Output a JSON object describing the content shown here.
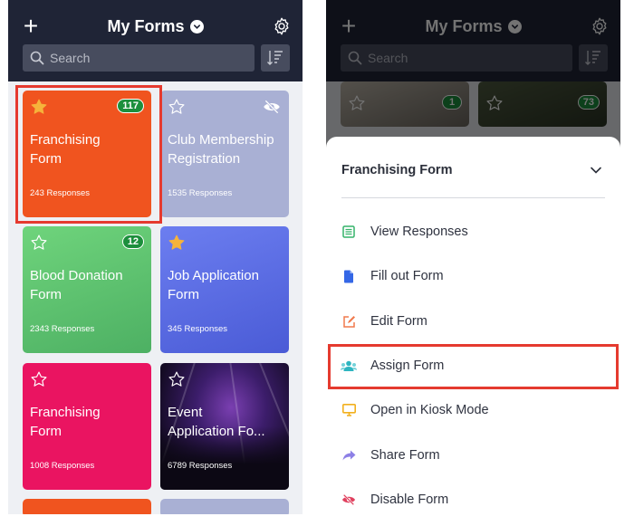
{
  "app": {
    "title": "My Forms"
  },
  "search": {
    "placeholder": "Search"
  },
  "cards": [
    {
      "name_line1": "Franchising",
      "name_line2": "Form",
      "responses": "243 Responses",
      "badge": "117",
      "starred": true,
      "color": "#f0541f"
    },
    {
      "name_line1": "Club Membership",
      "name_line2": "Registration",
      "responses": "1535 Responses",
      "hidden_icon": true,
      "starred": false,
      "color": "#a9b0d4"
    },
    {
      "name_line1": "Blood Donation",
      "name_line2": "Form",
      "responses": "2343 Responses",
      "badge": "12",
      "starred": false,
      "color": "#5fc26f"
    },
    {
      "name_line1": "Job Application",
      "name_line2": "Form",
      "responses": "345 Responses",
      "starred": true,
      "color": "#5b6ee0"
    },
    {
      "name_line1": "Franchising",
      "name_line2": "Form",
      "responses": "1008 Responses",
      "starred": false,
      "color": "#ea1461"
    },
    {
      "name_line1": "Event",
      "name_line2": "Application Fo...",
      "responses": "6789 Responses",
      "starred": false,
      "color": "#2a163f"
    }
  ],
  "peek_badges": [
    "1",
    "73"
  ],
  "sheet": {
    "title": "Franchising Form",
    "actions": [
      {
        "label": "View Responses",
        "icon": "view-responses-icon",
        "color": "#35b36a"
      },
      {
        "label": "Fill out Form",
        "icon": "document-icon",
        "color": "#3467e6"
      },
      {
        "label": "Edit Form",
        "icon": "edit-icon",
        "color": "#f07a4d"
      },
      {
        "label": "Assign Form",
        "icon": "assign-users-icon",
        "color": "#2eb5c0"
      },
      {
        "label": "Open in Kiosk Mode",
        "icon": "monitor-icon",
        "color": "#f2b01e"
      },
      {
        "label": "Share Form",
        "icon": "share-icon",
        "color": "#8d80e6"
      },
      {
        "label": "Disable Form",
        "icon": "disable-icon",
        "color": "#e0405e"
      }
    ]
  },
  "colors": {
    "header": "#1f2436",
    "highlight": "#e53a2f"
  }
}
